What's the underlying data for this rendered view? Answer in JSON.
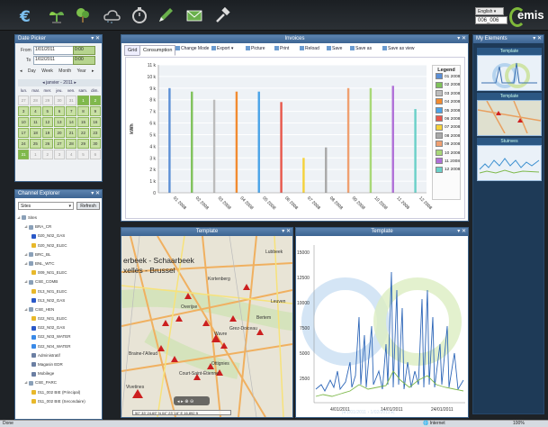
{
  "toolbar": {
    "icons": [
      "euro-icon",
      "plant-icon",
      "tree-icon",
      "weather-icon",
      "timer-icon",
      "pencil-icon",
      "mail-icon",
      "hammer-icon"
    ],
    "language": "English",
    "site_code": "006_006",
    "logo": "emis"
  },
  "date_picker": {
    "title": "Date Picker",
    "from_label": "From",
    "from_date": "1/01/2011",
    "from_time": "0:00",
    "to_label": "To",
    "to_date": "1/02/2011",
    "to_time": "0:00",
    "ranges": [
      "Day",
      "Week",
      "Month",
      "Year"
    ],
    "month_label": "janvier - 2011",
    "days_of_week": [
      "lun.",
      "mar.",
      "mer.",
      "jeu.",
      "ven.",
      "sam.",
      "dim."
    ],
    "days": [
      "27",
      "28",
      "29",
      "30",
      "31",
      "1",
      "2",
      "3",
      "4",
      "5",
      "6",
      "7",
      "8",
      "9",
      "10",
      "11",
      "12",
      "13",
      "14",
      "15",
      "16",
      "17",
      "18",
      "19",
      "20",
      "21",
      "22",
      "23",
      "24",
      "25",
      "26",
      "27",
      "28",
      "29",
      "30",
      "31",
      "1",
      "2",
      "3",
      "4",
      "5",
      "6"
    ]
  },
  "explorer": {
    "title": "Channel Explorer",
    "filter": "Sites",
    "refresh_label": "Refresh",
    "tree": [
      {
        "label": "Sites",
        "depth": 0,
        "color": "#8aa0b8"
      },
      {
        "label": "BRA_CR",
        "depth": 1,
        "color": "#8aa0b8"
      },
      {
        "label": "020_N02_GAS",
        "depth": 2,
        "color": "#2a58c8"
      },
      {
        "label": "020_N02_ELEC",
        "depth": 2,
        "color": "#e8b82a"
      },
      {
        "label": "BRC_BL",
        "depth": 1,
        "color": "#8aa0b8"
      },
      {
        "label": "BNL_WTC",
        "depth": 1,
        "color": "#8aa0b8"
      },
      {
        "label": "009_N01_ELEC",
        "depth": 2,
        "color": "#e8b82a"
      },
      {
        "label": "CSE_COMB",
        "depth": 1,
        "color": "#8aa0b8"
      },
      {
        "label": "013_N01_ELEC",
        "depth": 2,
        "color": "#e8b82a"
      },
      {
        "label": "013_N02_GAS",
        "depth": 2,
        "color": "#2a58c8"
      },
      {
        "label": "CSE_HEN",
        "depth": 1,
        "color": "#8aa0b8"
      },
      {
        "label": "022_N01_ELEC",
        "depth": 2,
        "color": "#e8b82a"
      },
      {
        "label": "022_N02_GAS",
        "depth": 2,
        "color": "#2a58c8"
      },
      {
        "label": "022_N03_WATER",
        "depth": 2,
        "color": "#3a8ae8"
      },
      {
        "label": "022_N04_WATER",
        "depth": 2,
        "color": "#3a8ae8"
      },
      {
        "label": "Administratif",
        "depth": 2,
        "color": "#6b7fa3"
      },
      {
        "label": "Magasin EDR",
        "depth": 2,
        "color": "#6b7fa3"
      },
      {
        "label": "Mobilege",
        "depth": 2,
        "color": "#6b7fa3"
      },
      {
        "label": "CSE_PARC",
        "depth": 1,
        "color": "#8aa0b8"
      },
      {
        "label": "011_002 BIE (Principal)",
        "depth": 2,
        "color": "#e8b82a"
      },
      {
        "label": "011_002 BIE (Secondaire)",
        "depth": 2,
        "color": "#e8b82a"
      }
    ]
  },
  "invoices": {
    "title": "Invoices",
    "tabs": [
      "Grid",
      "Consumption"
    ],
    "buttons": [
      "Change Mode",
      "Export",
      "Picture",
      "Print",
      "Reload",
      "Save",
      "Save as",
      "Save as view"
    ]
  },
  "my_elements": {
    "title": "My Elements",
    "items": [
      "Template",
      "Template",
      "Stuinves"
    ]
  },
  "map_panel": {
    "title": "Template",
    "labels": [
      {
        "t": "erbeek - Schaarbeek",
        "big": true
      },
      {
        "t": "xelles - Brussel",
        "big": true
      },
      {
        "t": "Lubbeek"
      },
      {
        "t": "Kortenberg"
      },
      {
        "t": "Leuven"
      },
      {
        "t": "Bertem"
      },
      {
        "t": "Overijse"
      },
      {
        "t": "Grez-Doiceau"
      },
      {
        "t": "Wavre"
      },
      {
        "t": "Braine-l'Alleud"
      },
      {
        "t": "Court-Saint-Étienne"
      },
      {
        "t": "Ottignies"
      },
      {
        "t": "Vivetines"
      }
    ],
    "scale_text": "50° 33' 24.69\" N  04° 23' 18\" E   16,892 ft"
  },
  "line_panel": {
    "title": "Template",
    "y_ticks": [
      "15000",
      "12500",
      "10000",
      "7500",
      "5000",
      "2500"
    ],
    "x_ticks": [
      "4/01/2011",
      "14/01/2011",
      "24/01/2011"
    ]
  },
  "pager": {
    "from": "1/01/2011",
    "to": "1/02/2011"
  },
  "status": {
    "left": "Done",
    "right_internet": "Internet",
    "zoom": "100%"
  },
  "chart_data": {
    "type": "bar",
    "title": "Invoices",
    "ylabel": "kWh",
    "xlabel": "",
    "categories": [
      "01 2008",
      "02 2008",
      "03 2008",
      "04 2008",
      "05 2008",
      "06 2008",
      "07 2008",
      "08 2008",
      "09 2008",
      "10 2008",
      "11 2008",
      "12 2008"
    ],
    "values": [
      9000,
      8700,
      8000,
      8700,
      8700,
      7800,
      3000,
      3900,
      9000,
      9000,
      9200,
      7200
    ],
    "colors": [
      "#5b8fd6",
      "#7fc25a",
      "#bcbcbc",
      "#f28b30",
      "#4aa3e8",
      "#e8564a",
      "#f5d23a",
      "#a8a8a8",
      "#f0a070",
      "#a8d878",
      "#b070d8",
      "#6ad0c8"
    ],
    "ylim": [
      0,
      11000
    ],
    "y_ticks": [
      "0",
      "1 k",
      "2 k",
      "3 k",
      "4 k",
      "5 k",
      "6 k",
      "7 k",
      "8 k",
      "9 k",
      "10 k",
      "11 k"
    ],
    "legend_title": "Legend",
    "legend_position": "right",
    "grid": true
  }
}
